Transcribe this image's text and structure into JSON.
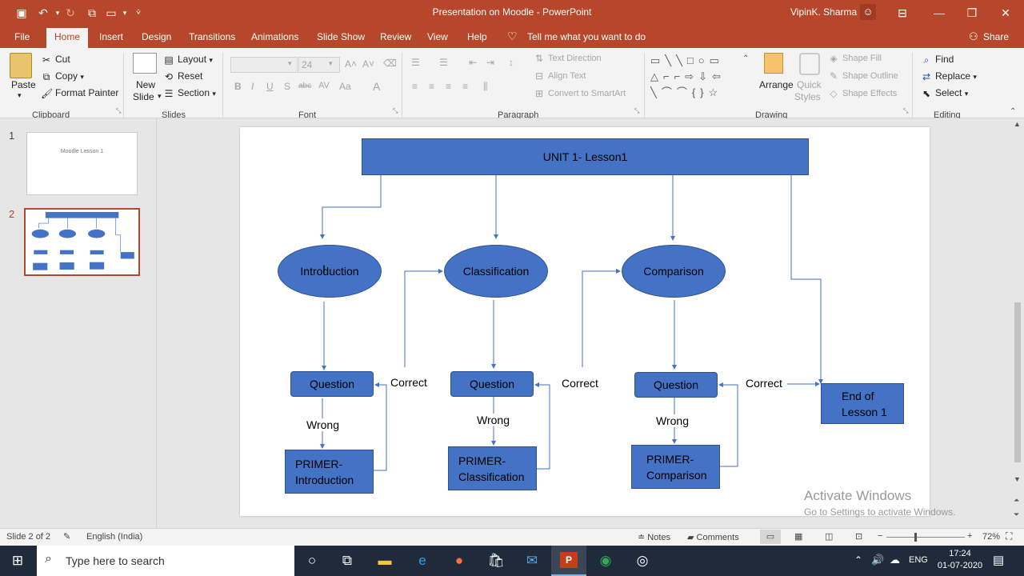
{
  "titlebar": {
    "title": "Presentation on Moodle  -  PowerPoint",
    "user": "VipinK. Sharma"
  },
  "tabs": [
    "File",
    "Home",
    "Insert",
    "Design",
    "Transitions",
    "Animations",
    "Slide Show",
    "Review",
    "View",
    "Help"
  ],
  "tell_me": "Tell me what you want to do",
  "share": "Share",
  "ribbon": {
    "clipboard": {
      "paste": "Paste",
      "cut": "Cut",
      "copy": "Copy",
      "format_painter": "Format Painter",
      "group": "Clipboard"
    },
    "slides": {
      "new_slide": "New",
      "new_slide2": "Slide",
      "layout": "Layout",
      "reset": "Reset",
      "section": "Section",
      "group": "Slides"
    },
    "font": {
      "size": "24",
      "group": "Font"
    },
    "paragraph": {
      "text_direction": "Text Direction",
      "align_text": "Align Text",
      "convert": "Convert to SmartArt",
      "group": "Paragraph"
    },
    "drawing": {
      "arrange": "Arrange",
      "quick_styles": "Quick",
      "quick_styles2": "Styles",
      "shape_fill": "Shape Fill",
      "shape_outline": "Shape Outline",
      "shape_effects": "Shape Effects",
      "group": "Drawing"
    },
    "editing": {
      "find": "Find",
      "replace": "Replace",
      "select": "Select",
      "group": "Editing"
    }
  },
  "thumbnails": [
    {
      "num": "1",
      "text": "Moodle Lesson 1"
    },
    {
      "num": "2"
    }
  ],
  "slide": {
    "unit": "UNIT 1- Lesson1",
    "introduction": "Introduction",
    "classification": "Classification",
    "comparison": "Comparison",
    "question": "Question",
    "correct": "Correct",
    "wrong": "Wrong",
    "primer_intro_1": "PRIMER-",
    "primer_intro_2": "Introduction",
    "primer_class_1": "PRIMER-",
    "primer_class_2": "Classification",
    "primer_comp_1": "PRIMER-",
    "primer_comp_2": "Comparison",
    "end_1": "End of",
    "end_2": "Lesson 1"
  },
  "activate": {
    "line1": "Activate Windows",
    "line2": "Go to Settings to activate Windows."
  },
  "status": {
    "slide": "Slide 2 of 2",
    "lang": "English (India)",
    "notes": "Notes",
    "comments": "Comments",
    "zoom": "72%"
  },
  "taskbar": {
    "search": "Type here to search",
    "lang": "ENG",
    "time": "17:24",
    "date": "01-07-2020"
  },
  "colors": {
    "accent": "#b7472a",
    "shape": "#4472c4",
    "connector": "#4472c4"
  }
}
